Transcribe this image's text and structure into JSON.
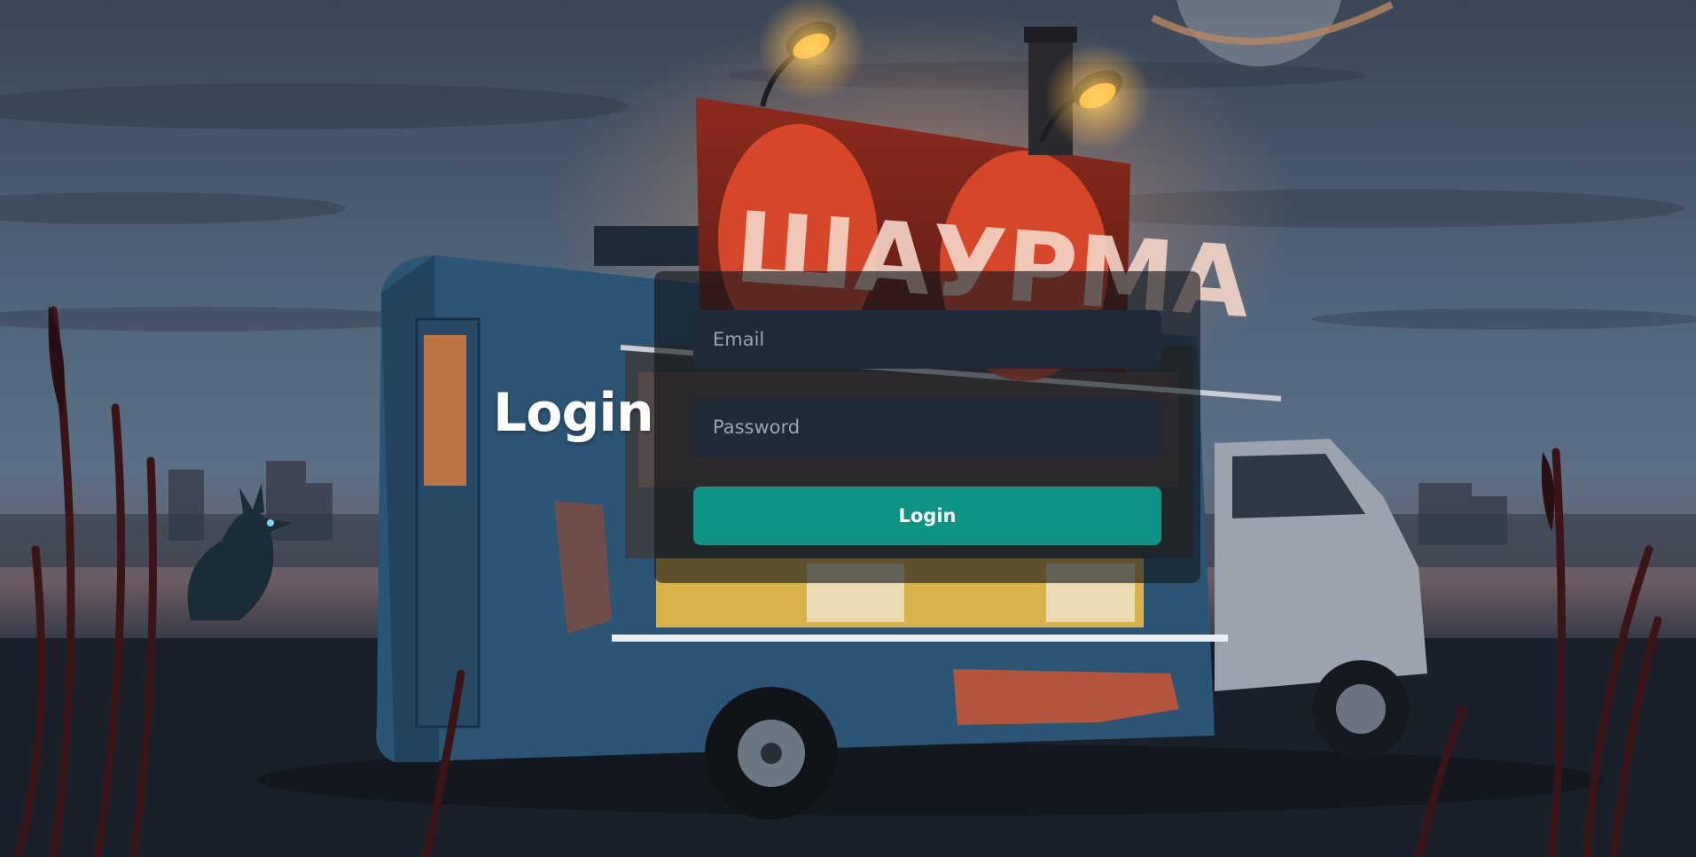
{
  "background": {
    "sign_text": "ШАУРМА"
  },
  "login_heading": "Login",
  "form": {
    "email_placeholder": "Email",
    "password_placeholder": "Password",
    "submit_label": "Login"
  },
  "colors": {
    "accent": "#0e9384",
    "field_bg": "#1f2937",
    "panel_bg": "#11161c"
  }
}
